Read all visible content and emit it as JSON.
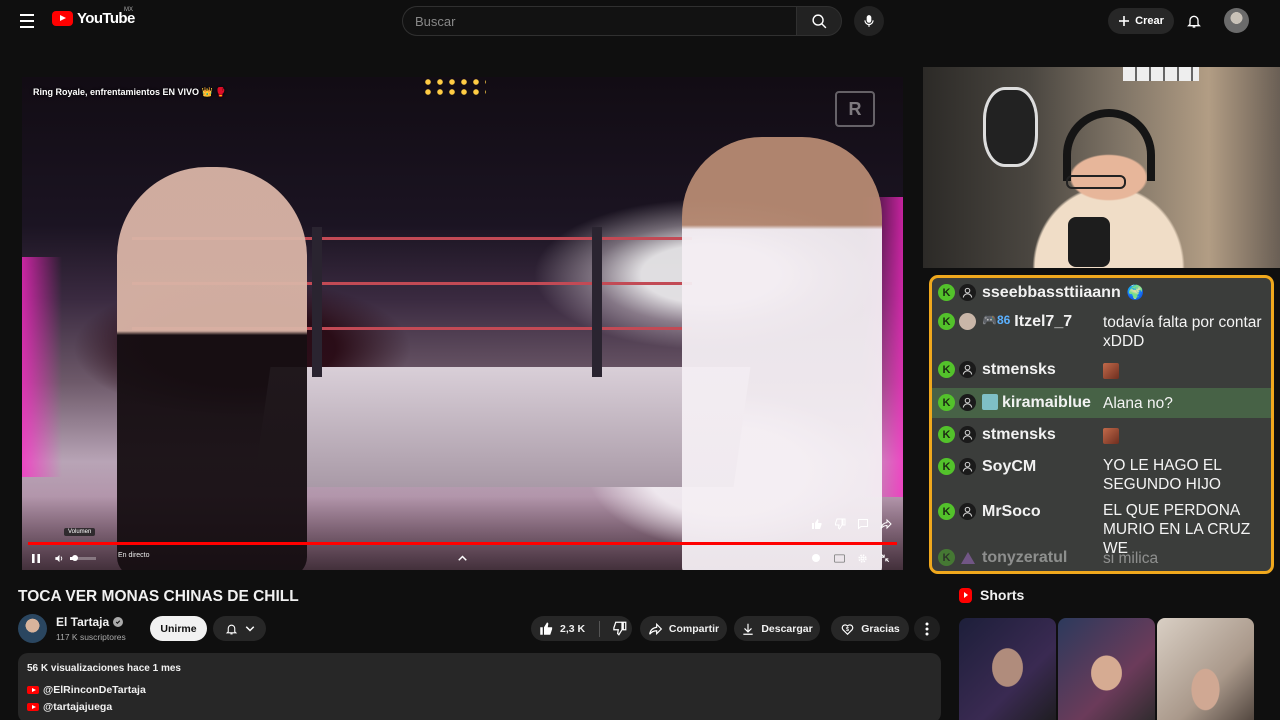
{
  "header": {
    "logo_text": "YouTube",
    "country": "MX",
    "search_placeholder": "Buscar",
    "create_label": "Crear"
  },
  "player": {
    "overlay_title": "Ring Royale, enfrentamientos EN VIVO 👑 🥊",
    "watermark": "R",
    "live_label": "En directo",
    "volume_tooltip": "Volumen",
    "progress": 1.0,
    "volume": 0.2
  },
  "chat": {
    "messages": [
      {
        "user": "sseebbassttiiaann",
        "badges": [
          "🌍"
        ],
        "text": "",
        "highlight": false,
        "faded": false
      },
      {
        "user": "Itzel7_7",
        "prefix": "🎮86",
        "text": "todavía falta por contar xDDD",
        "highlight": false,
        "faded": false
      },
      {
        "user": "stmensks",
        "text": "",
        "emote": true,
        "highlight": false,
        "faded": false
      },
      {
        "user": "kiramaiblue",
        "text": "Alana no?",
        "highlight": true,
        "faded": false
      },
      {
        "user": "stmensks",
        "text": "",
        "emote": true,
        "highlight": false,
        "faded": false
      },
      {
        "user": "SoyCM",
        "text": "YO LE HAGO EL SEGUNDO HIJO",
        "highlight": false,
        "faded": false
      },
      {
        "user": "MrSoco",
        "text": "EL QUE PERDONA MURIO EN LA CRUZ WE",
        "highlight": false,
        "faded": false
      },
      {
        "user": "tonyzeratul",
        "text": "si milica",
        "highlight": false,
        "faded": true
      }
    ]
  },
  "video": {
    "title": "TOCA VER MONAS CHINAS DE CHILL",
    "channel_name": "El Tartaja",
    "subscribers": "117 K suscriptores",
    "join_label": "Unirme",
    "likes": "2,3 K",
    "share_label": "Compartir",
    "download_label": "Descargar",
    "thanks_label": "Gracias"
  },
  "description": {
    "meta": "56 K visualizaciones  hace 1 mes",
    "links": [
      "@ElRinconDeTartaja",
      "@tartajajuega"
    ]
  },
  "shorts": {
    "heading": "Shorts"
  },
  "colors": {
    "accent": "#ff0000",
    "chat_border": "#f0a81d",
    "chat_bg": "#3b3d3b",
    "chat_highlight": "#476246",
    "badge_green": "#53c22b"
  }
}
